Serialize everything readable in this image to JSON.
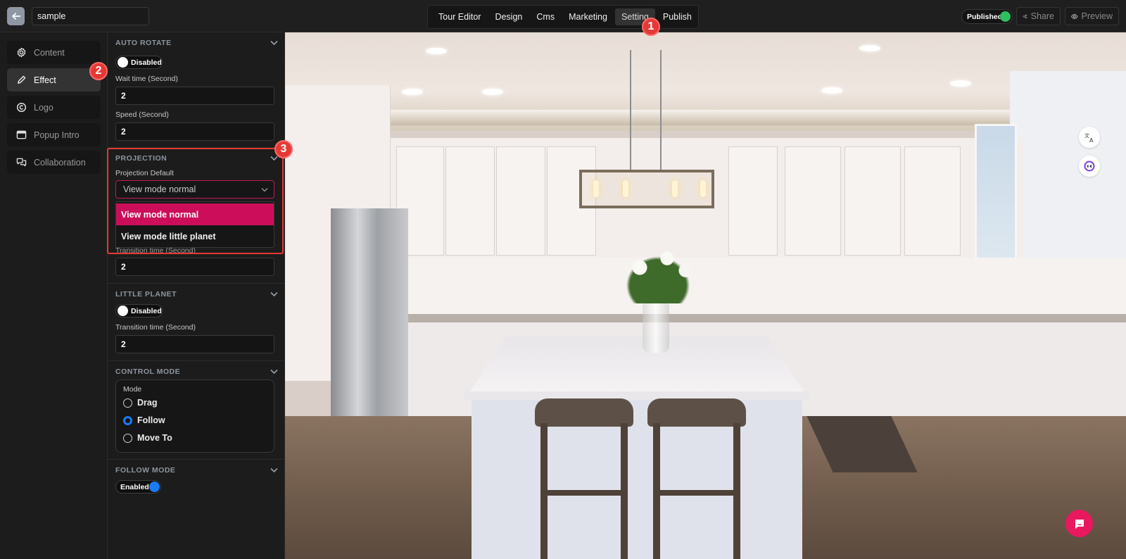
{
  "header": {
    "project_name": "sample",
    "tabs": [
      {
        "label": "Tour Editor",
        "active": false
      },
      {
        "label": "Design",
        "active": false
      },
      {
        "label": "Cms",
        "active": false
      },
      {
        "label": "Marketing",
        "active": false
      },
      {
        "label": "Setting",
        "active": true
      },
      {
        "label": "Publish",
        "active": false
      }
    ],
    "published_label": "Published",
    "published_state": true,
    "share_label": "Share",
    "preview_label": "Preview"
  },
  "sidebar": {
    "items": [
      {
        "label": "Content",
        "icon": "gear-icon",
        "active": false
      },
      {
        "label": "Effect",
        "icon": "pencil-icon",
        "active": true
      },
      {
        "label": "Logo",
        "icon": "copyright-icon",
        "active": false
      },
      {
        "label": "Popup Intro",
        "icon": "window-icon",
        "active": false
      },
      {
        "label": "Collaboration",
        "icon": "chat-bubbles-icon",
        "active": false
      }
    ]
  },
  "panel": {
    "auto_rotate": {
      "title": "AUTO ROTATE",
      "toggle_label": "Disabled",
      "enabled": false,
      "wait_label": "Wait time (Second)",
      "wait_value": "2",
      "speed_label": "Speed (Second)",
      "speed_value": "2"
    },
    "projection": {
      "title": "PROJECTION",
      "default_label": "Projection Default",
      "selected": "View mode normal",
      "options": [
        "View mode normal",
        "View mode little planet"
      ],
      "hidden_label": "Transition time (Second)",
      "hidden_value": "2"
    },
    "little_planet": {
      "title": "LITTLE PLANET",
      "toggle_label": "Disabled",
      "enabled": false,
      "transition_label": "Transition time (Second)",
      "transition_value": "2"
    },
    "control_mode": {
      "title": "CONTROL MODE",
      "group_label": "Mode",
      "options": [
        {
          "label": "Drag",
          "checked": false
        },
        {
          "label": "Follow",
          "checked": true
        },
        {
          "label": "Move To",
          "checked": false
        }
      ]
    },
    "follow_mode": {
      "title": "FOLLOW MODE",
      "toggle_label": "Enabled",
      "enabled": true
    }
  },
  "annotations": {
    "markers": [
      "1",
      "2",
      "3"
    ]
  },
  "viewer": {
    "scene": "kitchen panorama",
    "floating_buttons": [
      "translate-icon",
      "assistant-icon"
    ],
    "chat_button": "chat-icon"
  },
  "colors": {
    "accent_pink": "#cc0e5a",
    "toggle_blue": "#1a7cf5",
    "published_green": "#2fbf5f",
    "marker_red": "#e53935"
  }
}
